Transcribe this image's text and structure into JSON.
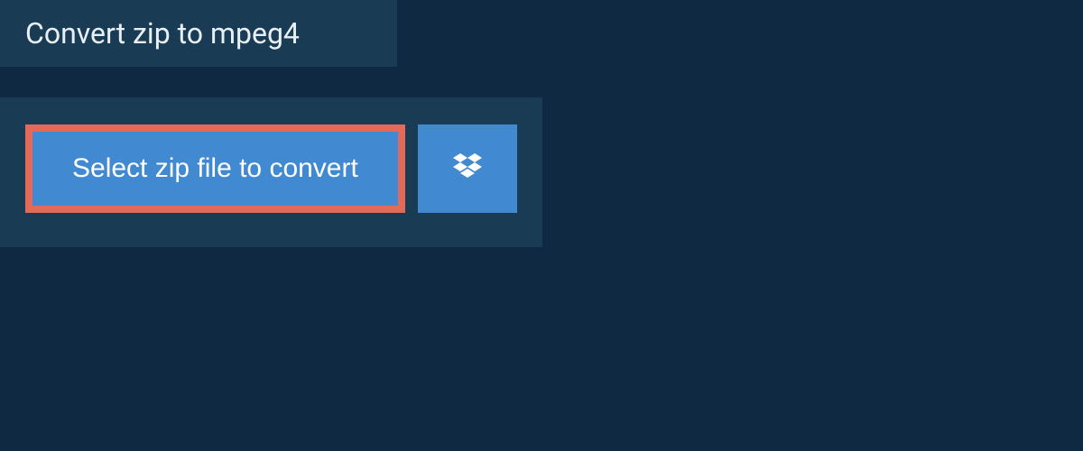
{
  "header": {
    "title": "Convert zip to mpeg4"
  },
  "actions": {
    "select_file_label": "Select zip file to convert"
  },
  "colors": {
    "background": "#0f2942",
    "panel": "#193b54",
    "button": "#4189d1",
    "highlight_border": "#e26a5a"
  }
}
